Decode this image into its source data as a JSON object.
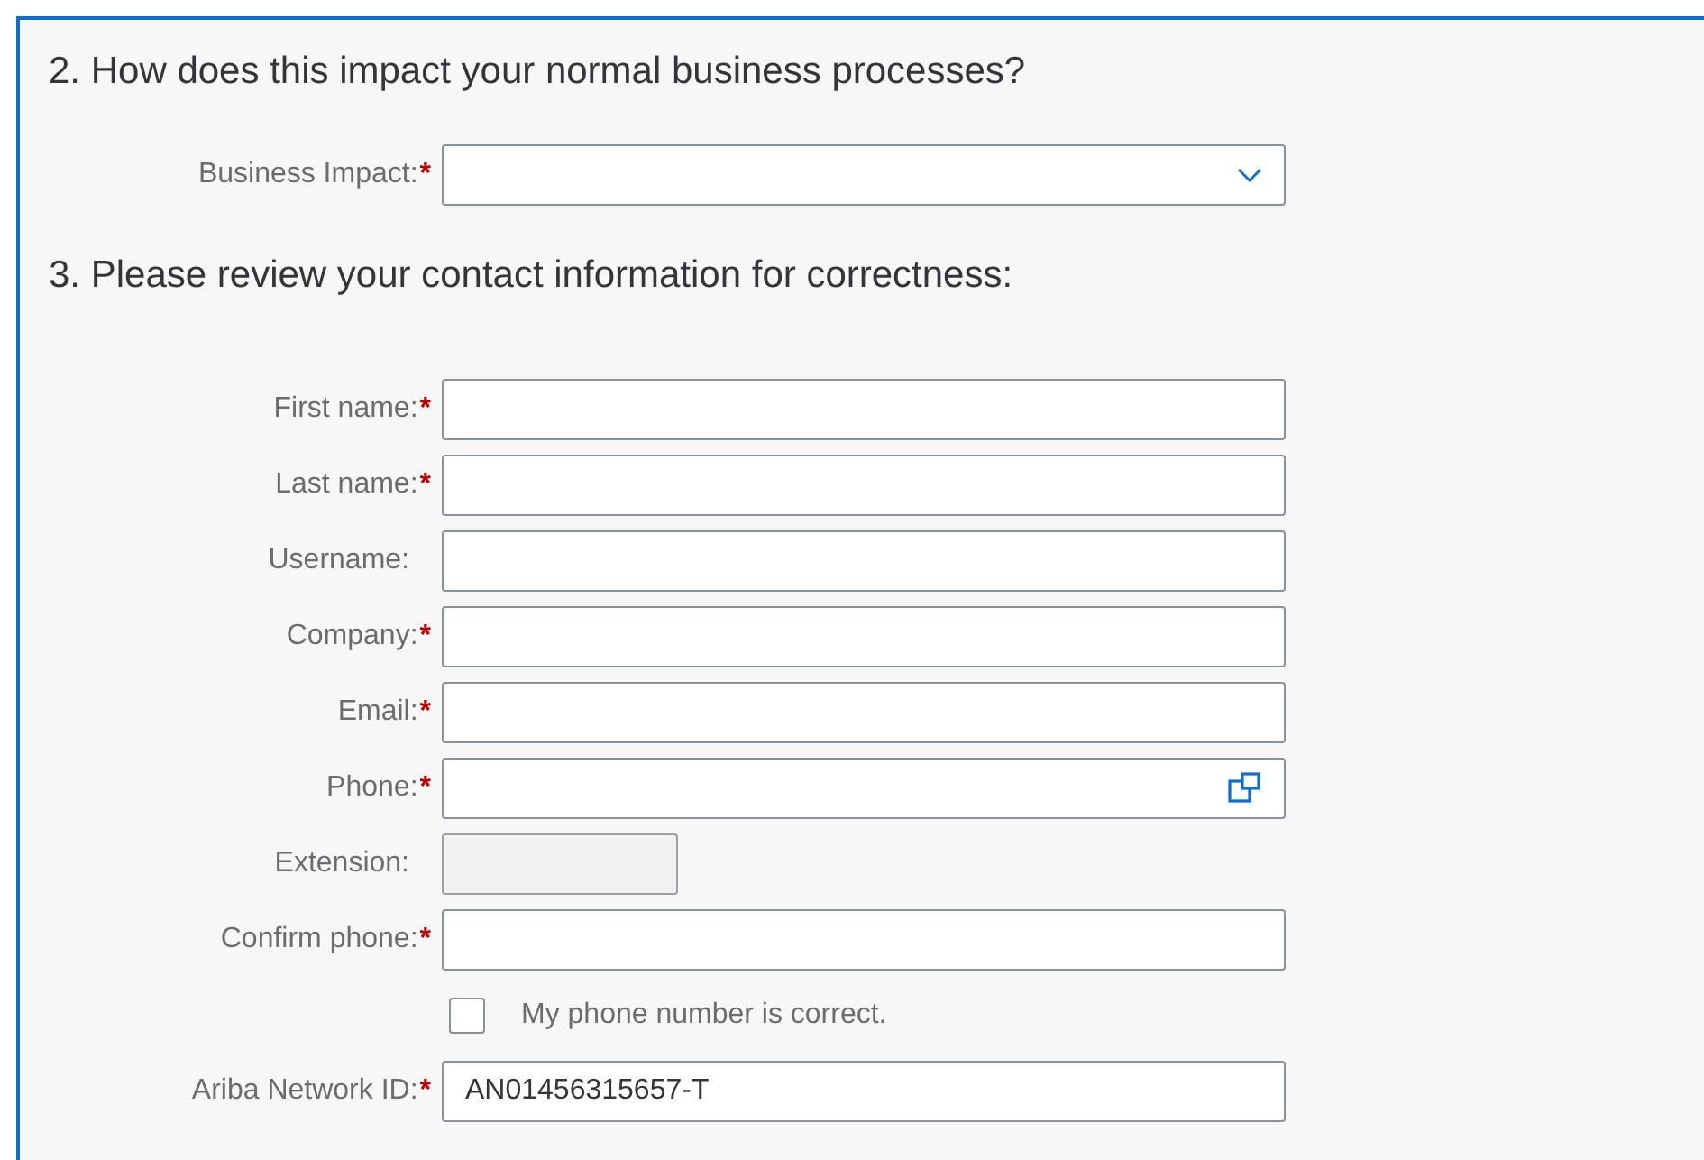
{
  "sections": [
    {
      "heading": "2. How does this impact your normal business processes?",
      "fields": [
        {
          "kind": "select",
          "label": "Business Impact:",
          "required_mark": "*"
        }
      ]
    },
    {
      "heading": "3. Please review your contact information for correctness:",
      "fields": [
        {
          "kind": "text",
          "label": "First name:",
          "required_mark": "*"
        },
        {
          "kind": "text",
          "label": "Last name:",
          "required_mark": "*"
        },
        {
          "kind": "text",
          "label": "Username:"
        },
        {
          "kind": "text",
          "label": "Company:",
          "required_mark": "*"
        },
        {
          "kind": "text",
          "label": "Email:",
          "required_mark": "*"
        },
        {
          "kind": "phone",
          "label": "Phone:",
          "required_mark": "*"
        },
        {
          "kind": "text",
          "label": "Extension:",
          "disabled": true
        },
        {
          "kind": "text",
          "label": "Confirm phone:",
          "required_mark": "*"
        },
        {
          "kind": "checkbox",
          "label": "My phone number is correct.",
          "checked": false
        },
        {
          "kind": "text",
          "label": "Ariba Network ID:",
          "required_mark": "*",
          "value": "AN01456315657-T"
        }
      ]
    }
  ]
}
